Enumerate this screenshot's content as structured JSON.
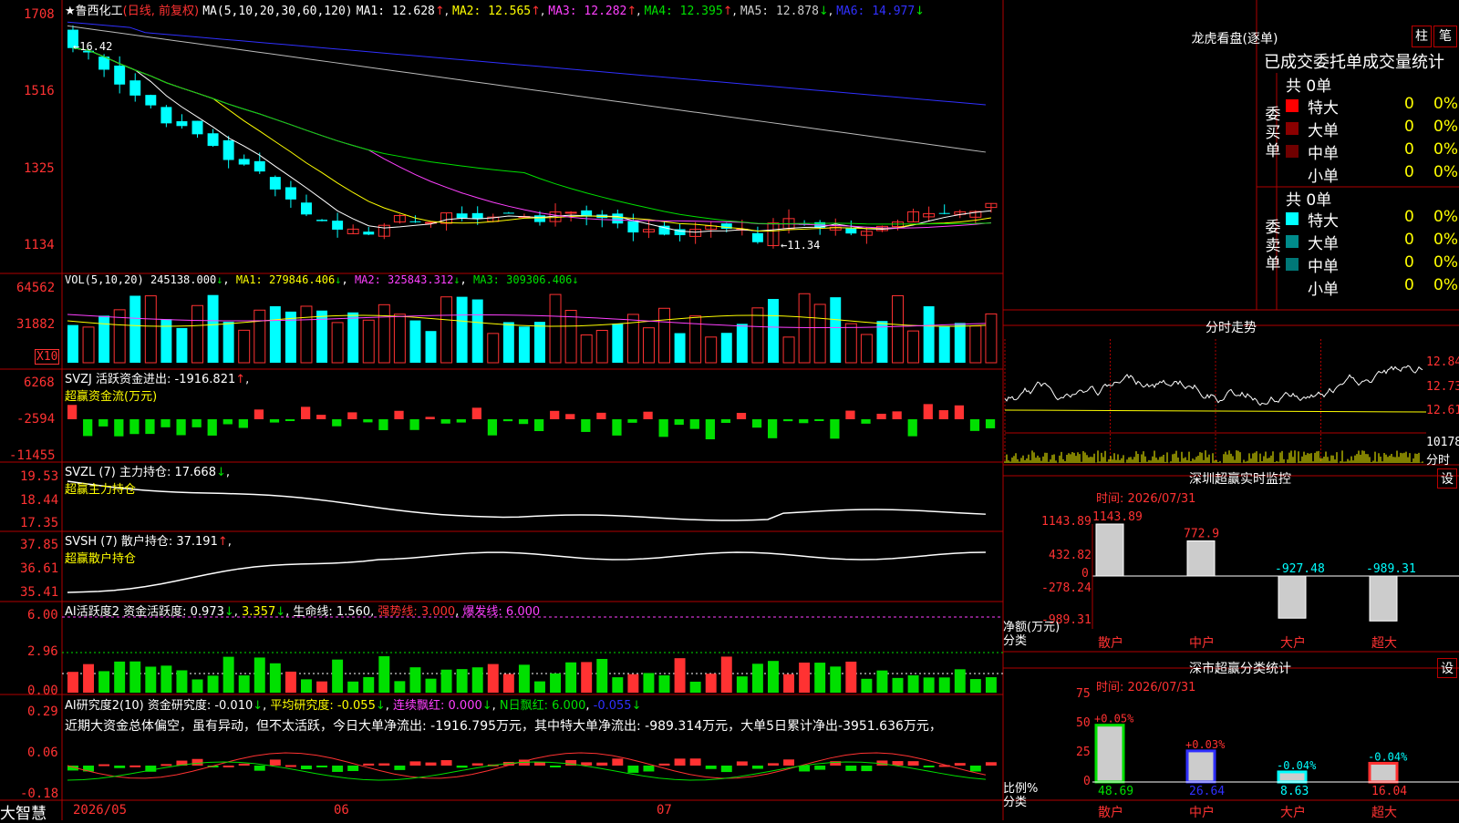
{
  "stock": {
    "name": "鲁西化工",
    "period": "(日线, 前复权)",
    "ma_label": "MA(5,10,20,30,60,120)",
    "ma1": "MA1: 12.628",
    "ma2": "MA2: 12.565",
    "ma3": "MA3: 12.282",
    "ma4": "MA4: 12.395",
    "ma5": "MA5: 12.878",
    "ma6": "MA6: 14.977",
    "high_marker": "16.42",
    "low_marker": "11.34"
  },
  "price_axis": [
    "1708",
    "1516",
    "1325",
    "1134"
  ],
  "vol": {
    "label": "VOL(5,10,20)",
    "value": "245138.000",
    "ma1": "MA1: 279846.406",
    "ma2": "MA2: 325843.312",
    "ma3": "MA3: 309306.406",
    "axis": [
      "64562",
      "31882"
    ],
    "unit": "X10"
  },
  "svzj": {
    "label": "SVZJ  活跃资金进出: -1916.821",
    "sub": "超赢资金流(万元)",
    "axis": [
      "6268",
      "-2594",
      "-11455"
    ]
  },
  "svzl": {
    "label": "SVZL (7) 主力持仓: 17.668",
    "sub": "超赢主力持仓",
    "axis": [
      "19.53",
      "18.44",
      "17.35"
    ]
  },
  "svsh": {
    "label": "SVSH (7) 散户持仓: 37.191",
    "sub": "超赢散户持仓",
    "axis": [
      "37.85",
      "36.61",
      "35.41"
    ]
  },
  "ai_active": {
    "label": "AI活跃度2 资金活跃度: 0.973",
    "v2": "3.357",
    "life": "生命线: 1.560",
    "strong": "强势线: 3.000",
    "burst": "爆发线: 6.000",
    "axis": [
      "6.00",
      "2.96",
      "0.00"
    ]
  },
  "ai_research": {
    "label": "AI研究度2(10) 资金研究度: -0.010",
    "avg": "平均研究度: -0.055",
    "cont": "连续飘红: 0.000",
    "nday": "N日飘红: 6.000",
    "last": "-0.055",
    "comment": "近期大资金总体偏空，虽有异动，但不太活跃，今日大单净流出: -1916.795万元，其中特大单净流出: -989.314万元，大单5日累计净出-3951.636万元，",
    "axis": [
      "0.29",
      "0.06",
      "-0.18"
    ]
  },
  "bottom": {
    "brand": "大智慧",
    "d1": "2026/05",
    "d2": "06",
    "d3": "07"
  },
  "right": {
    "lhb_title": "龙虎看盘(逐单)",
    "btn1": "柱",
    "btn2": "笔",
    "tabs_title": "已成交委托单成交量统计",
    "buy_label": "委买单",
    "sell_label": "委卖单",
    "buy_total": "共 0单",
    "sell_total": "共 0单",
    "buy_rows": [
      {
        "name": "特大",
        "n": "0",
        "p": "0%"
      },
      {
        "name": "大单",
        "n": "0",
        "p": "0%"
      },
      {
        "name": "中单",
        "n": "0",
        "p": "0%"
      },
      {
        "name": "小单",
        "n": "0",
        "p": "0%"
      }
    ],
    "sell_rows": [
      {
        "name": "特大",
        "n": "0",
        "p": "0%"
      },
      {
        "name": "大单",
        "n": "0",
        "p": "0%"
      },
      {
        "name": "中单",
        "n": "0",
        "p": "0%"
      },
      {
        "name": "小单",
        "n": "0",
        "p": "0%"
      }
    ],
    "fenshi_title": "分时走势",
    "fenshi_axis": [
      "12.84",
      "12.73",
      "12.61",
      "10178",
      "分时"
    ],
    "sz_title": "深圳超赢实时监控",
    "set": "设",
    "time": "时间: 2026/07/31",
    "sz_axis": [
      "1143.89",
      "432.82",
      "0",
      "-278.24",
      "-989.31"
    ],
    "sz_bars": [
      {
        "cat": "散户",
        "label": "1143.89",
        "value": 1143.89
      },
      {
        "cat": "中户",
        "label": "772.9",
        "value": 772.9
      },
      {
        "cat": "大户",
        "label": "-927.48",
        "value": -927.48
      },
      {
        "cat": "超大",
        "label": "-989.31",
        "value": -989.31
      }
    ],
    "net_label": "净额(万元)",
    "class_label": "分类",
    "cls_title": "深市超赢分类统计",
    "cls_axis": [
      "75",
      "50",
      "25",
      "0"
    ],
    "cls_bars": [
      {
        "cat": "散户",
        "value": 48.69,
        "val_label": "48.69",
        "chg": "+0.05%"
      },
      {
        "cat": "中户",
        "value": 26.64,
        "val_label": "26.64",
        "chg": "+0.03%"
      },
      {
        "cat": "大户",
        "value": 8.63,
        "val_label": "8.63",
        "chg": "-0.04%"
      },
      {
        "cat": "超大",
        "value": 16.04,
        "val_label": "16.04",
        "chg": "-0.04%"
      }
    ],
    "ratio_label": "比例%",
    "class_label2": "分类"
  },
  "colors": {
    "up": "#ff3232",
    "down": "#00ffff",
    "grid": "#b00000",
    "bg": "#000000"
  }
}
